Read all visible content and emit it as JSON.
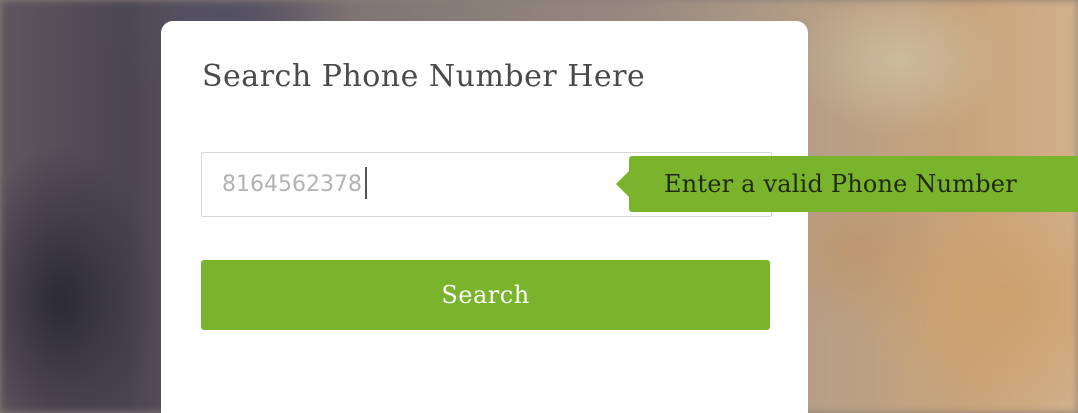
{
  "search_card": {
    "title": "Search Phone Number Here",
    "phone_input": {
      "value": "8164562378",
      "placeholder": ""
    },
    "search_button_label": "Search"
  },
  "validation_tooltip": {
    "message": "Enter a valid Phone Number"
  },
  "colors": {
    "accent": "#7ab32c",
    "card_background": "#ffffff",
    "title_text": "#4a4a4a",
    "input_text": "#b3b3b3"
  }
}
